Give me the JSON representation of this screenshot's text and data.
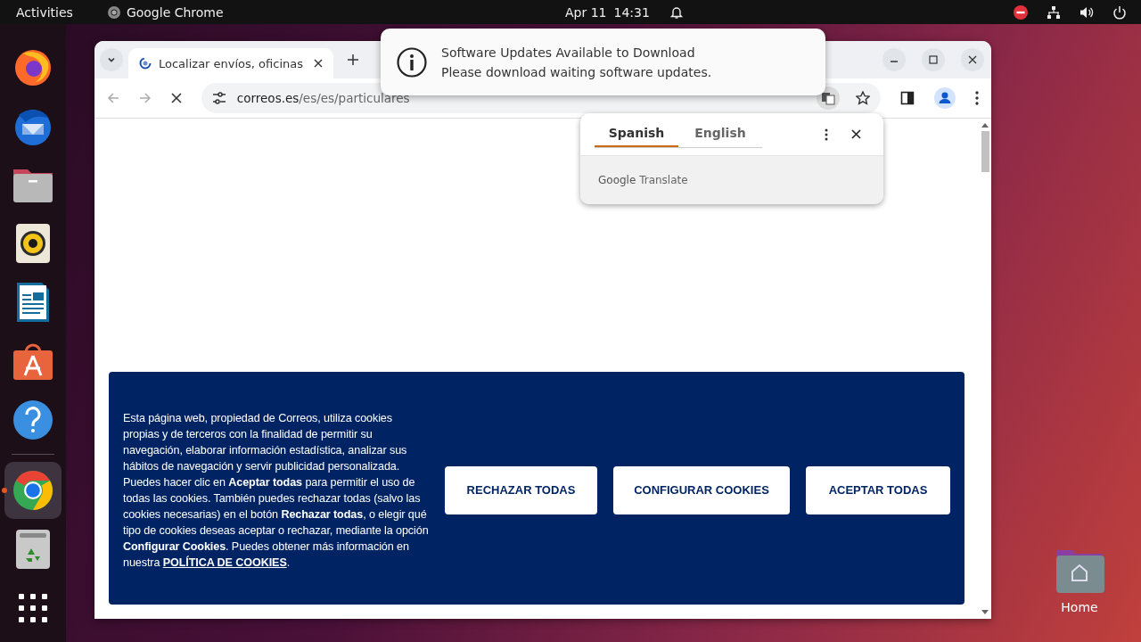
{
  "top_bar": {
    "activities": "Activities",
    "app_name": "Google Chrome",
    "date": "Apr 11",
    "time": "14:31"
  },
  "dock": {
    "pinned": [
      {
        "kind": "firefox",
        "running": false
      },
      {
        "kind": "thunderbird",
        "running": false
      },
      {
        "kind": "files",
        "running": false
      },
      {
        "kind": "rhythmbox",
        "running": false
      },
      {
        "kind": "writer",
        "running": false
      },
      {
        "kind": "appstore",
        "running": false
      },
      {
        "kind": "help",
        "running": false
      }
    ],
    "others": [
      {
        "kind": "chrome",
        "running": true
      },
      {
        "kind": "trash",
        "running": false
      },
      {
        "kind": "apps",
        "running": false
      }
    ]
  },
  "browser": {
    "tabs": [
      {
        "title": "Localizar envíos, oficinas",
        "selected": true
      }
    ],
    "address": {
      "domain": "correos.es",
      "path": "/es/es/particulares"
    }
  },
  "notification": {
    "title": "Software Updates Available to Download",
    "body": "Please download waiting software updates."
  },
  "translate_popup": {
    "tabs": [
      {
        "label": "Spanish",
        "selected": true
      },
      {
        "label": "English",
        "selected": false
      }
    ],
    "brand": "Google",
    "product": "Translate"
  },
  "cookie_banner": {
    "text": "Esta página web, propiedad de Correos, utiliza cookies propias y de terceros con la finalidad de permitir su navegación, elaborar información estadística, analizar sus hábitos de navegación y servir publicidad personalizada. Puedes hacer clic en **Aceptar todas** para permitir el uso de todas las cookies. También puedes rechazar todas (salvo las cookies necesarias) en el botón **Rechazar todas**, o elegir qué tipo de cookies deseas aceptar o rechazar, mediante la opción **Configurar Cookies**. Puedes obtener más información en nuestra ",
    "link": "POLÍTICA DE COOKIES",
    "text_after": ".",
    "buttons": [
      "RECHAZAR TODAS",
      "CONFIGURAR COOKIES",
      "ACEPTAR TODAS"
    ]
  },
  "desktop_icons": [
    {
      "label": "Home"
    }
  ]
}
